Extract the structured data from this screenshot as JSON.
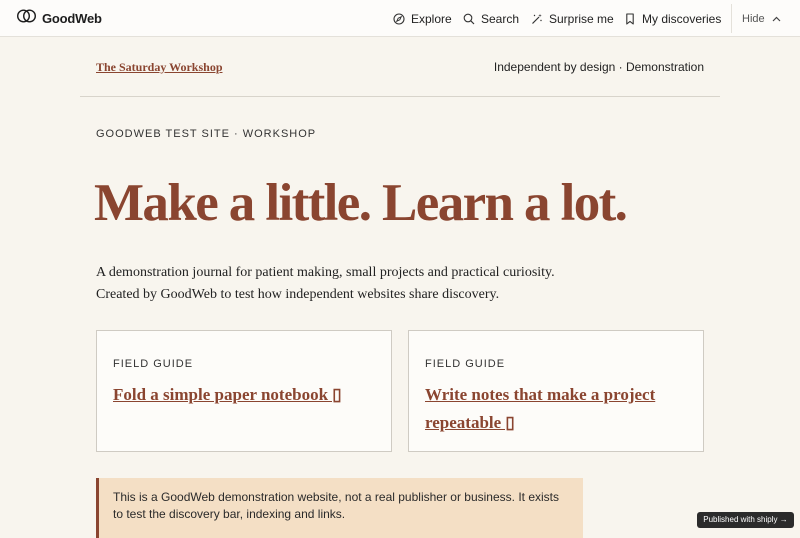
{
  "topbar": {
    "brand_name": "GoodWeb",
    "nav": [
      {
        "label": "Explore",
        "icon": "compass-icon"
      },
      {
        "label": "Search",
        "icon": "search-icon"
      },
      {
        "label": "Surprise me",
        "icon": "magic-wand-icon"
      },
      {
        "label": "My discoveries",
        "icon": "bookmark-icon"
      }
    ],
    "hide_label": "Hide",
    "hide_icon": "chevron-up-icon"
  },
  "site": {
    "title_link": "The Saturday Workshop",
    "tagline": "Independent by design · Demonstration"
  },
  "main": {
    "eyebrow": "GOODWEB TEST SITE · WORKSHOP",
    "headline": "Make a little. Learn a lot.",
    "intro": "A demonstration journal for patient making, small projects and practical curiosity. Created by GoodWeb to test how independent websites share discovery.",
    "cards": [
      {
        "label": "FIELD GUIDE",
        "title": "Fold a simple paper notebook ▯"
      },
      {
        "label": "FIELD GUIDE",
        "title": "Write notes that make a project repeatable ▯"
      }
    ],
    "notice": "This is a GoodWeb demonstration website, not a real publisher or business. It exists to test the discovery bar, indexing and links."
  },
  "footer_badge": "Published with shiply →",
  "colors": {
    "accent": "#8a4530",
    "page_background": "#f8f5ee",
    "notice_background": "#f4dfc5",
    "badge_background": "#2b2b2b"
  }
}
